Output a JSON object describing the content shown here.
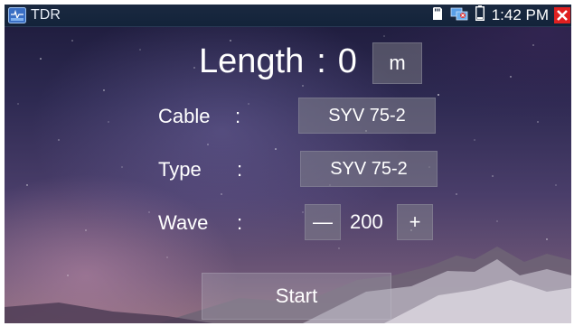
{
  "status_bar": {
    "app_title": "TDR",
    "time": "1:42 PM"
  },
  "length": {
    "label": "Length",
    "separator": ":",
    "value": "0",
    "unit": "m"
  },
  "cable": {
    "label": "Cable",
    "colon": ":",
    "value": "SYV 75-2"
  },
  "type": {
    "label": "Type",
    "colon": ":",
    "value": "SYV 75-2"
  },
  "wave": {
    "label": "Wave",
    "colon": ":",
    "decrement_label": "—",
    "value": "200",
    "increment_label": "+"
  },
  "start_button": {
    "label": "Start"
  },
  "colors": {
    "status_bar_bg": "#13233a",
    "close_button": "#e02020",
    "text": "#ffffff"
  },
  "icons": {
    "app": "tdr-app-icon",
    "storage": "sd-card-icon",
    "network": "network-icon",
    "battery": "battery-icon",
    "close": "close-icon"
  }
}
